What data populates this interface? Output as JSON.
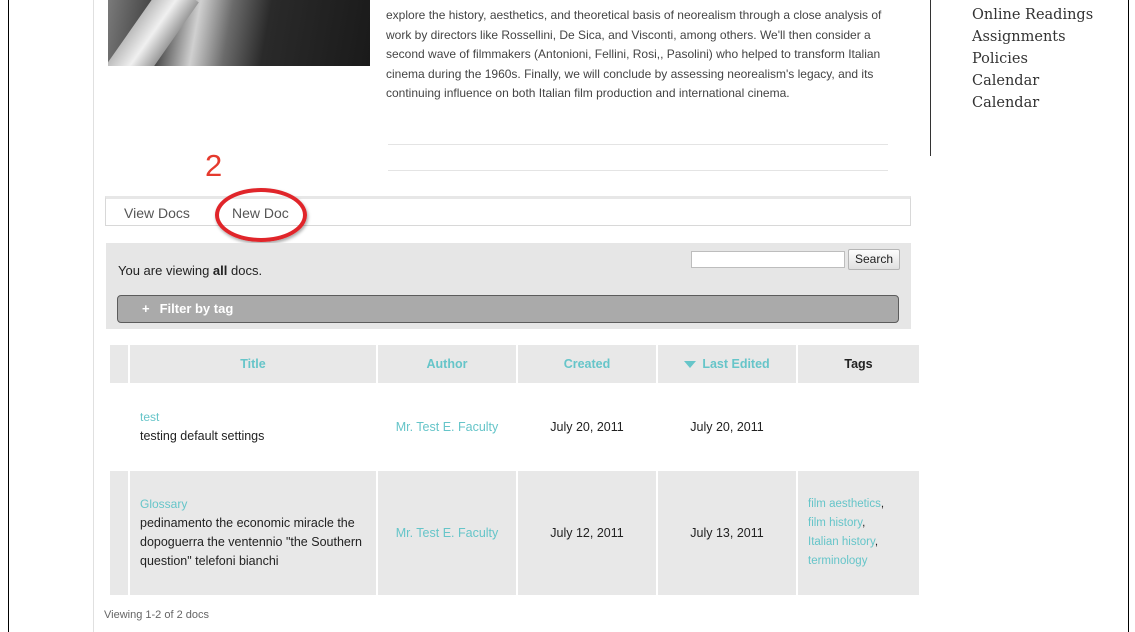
{
  "course": {
    "description": "explore the history, aesthetics, and theoretical basis of neorealism through a close analysis of work by directors like Rossellini, De Sica, and Visconti, among others. We'll then consider a second wave of filmmakers (Antonioni, Fellini, Rosi,, Pasolini) who helped to transform Italian cinema during the 1960s. Finally, we will conclude by assessing neorealism's legacy, and its continuing influence on both Italian film production and international cinema."
  },
  "side_nav": {
    "items": [
      "Online Readings",
      "Assignments",
      "Policies",
      "Calendar",
      "Calendar"
    ]
  },
  "annotation": {
    "number": "2"
  },
  "tabs": [
    {
      "label": "View Docs"
    },
    {
      "label": "New Doc"
    }
  ],
  "viewing": {
    "prefix": "You are viewing ",
    "scope": "all",
    "suffix": " docs."
  },
  "search": {
    "button_label": "Search",
    "value": ""
  },
  "filter": {
    "plus": "+",
    "label": "Filter by tag"
  },
  "table": {
    "headers": [
      "Title",
      "Author",
      "Created",
      "Last Edited",
      "Tags"
    ],
    "rows": [
      {
        "title": "test",
        "excerpt": "testing default settings",
        "author": "Mr. Test E. Faculty",
        "created": "July 20, 2011",
        "last_edited": "July 20, 2011",
        "tags": []
      },
      {
        "title": "Glossary",
        "excerpt": "pedinamento the economic miracle the dopoguerra the ventennio \"the Southern question\" telefoni bianchi",
        "author": "Mr. Test E. Faculty",
        "created": "July 12, 2011",
        "last_edited": "July 13, 2011",
        "tags": [
          "film aesthetics",
          "film history",
          "Italian history",
          "terminology"
        ]
      }
    ]
  },
  "footer": {
    "count": "Viewing 1-2 of 2 docs"
  },
  "colors": {
    "link": "#66c5c9",
    "annotation": "#e0252a",
    "panel": "#e6e6e6"
  }
}
